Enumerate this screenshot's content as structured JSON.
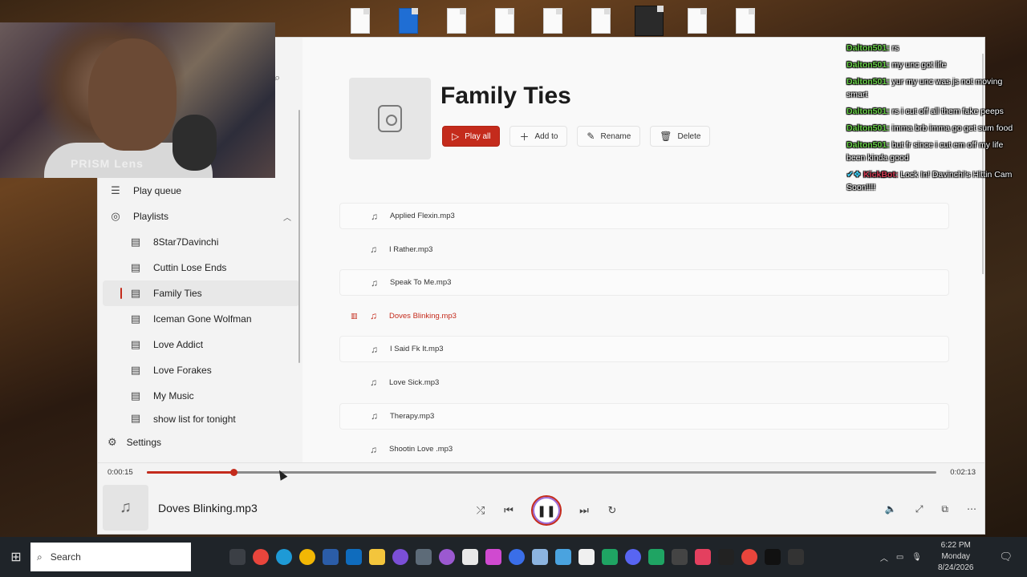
{
  "window": {
    "title_controls": [
      "─",
      "☐",
      "✕"
    ]
  },
  "sidebar": {
    "items": [
      {
        "label": "Play queue",
        "icon": "queue-icon"
      },
      {
        "label": "Playlists",
        "icon": "playlists-icon"
      }
    ],
    "playlists": [
      {
        "label": "8Star7Davinchi"
      },
      {
        "label": "Cuttin Lose Ends"
      },
      {
        "label": "Family Ties"
      },
      {
        "label": "Iceman Gone Wolfman"
      },
      {
        "label": "Love Addict"
      },
      {
        "label": "Love Forakes"
      },
      {
        "label": "My Music"
      },
      {
        "label": "show list for tonight"
      }
    ],
    "settings_label": "Settings"
  },
  "playlist": {
    "title": "Family Ties",
    "buttons": {
      "play_all": "Play all",
      "add_to": "Add to",
      "rename": "Rename",
      "delete": "Delete"
    },
    "tracks": [
      {
        "name": "Applied Flexin.mp3"
      },
      {
        "name": "I Rather.mp3"
      },
      {
        "name": "Speak To Me.mp3"
      },
      {
        "name": "Doves Blinking.mp3"
      },
      {
        "name": "I Said Fk It.mp3"
      },
      {
        "name": "Love Sick.mp3"
      },
      {
        "name": "Therapy.mp3"
      },
      {
        "name": "Shootin Love .mp3"
      }
    ]
  },
  "player": {
    "current_time": "0:00:15",
    "total_time": "0:02:13",
    "progress_fraction": 0.11,
    "now_playing": "Doves Blinking.mp3"
  },
  "webcam": {
    "overlay_text": "PRISM Lens"
  },
  "chat": [
    {
      "user": "Dalton501:",
      "text": " rs"
    },
    {
      "user": "Dalton501:",
      "text": " my unc got life"
    },
    {
      "user": "Dalton501:",
      "text": " yur my unc was js not moving smart"
    },
    {
      "user": "Dalton501:",
      "text": " rs i cut off all them fake peeps"
    },
    {
      "user": "Dalton501:",
      "text": " imma brb imma go get sum food"
    },
    {
      "user": "Dalton501:",
      "text": " but fr since i cut em off my life been kinda good"
    },
    {
      "user": "KickBot:",
      "text": " Lock In! Davinchi's Hittin Cam Soon!!!!",
      "bot": true
    }
  ],
  "taskbar": {
    "search_label": "Search",
    "time": "6:22 PM",
    "day": "Monday",
    "date": "8/24/2026"
  },
  "colors": {
    "accent": "#c42b1c",
    "chat_user": "#6bd34a",
    "chat_bot": "#d13a52"
  }
}
